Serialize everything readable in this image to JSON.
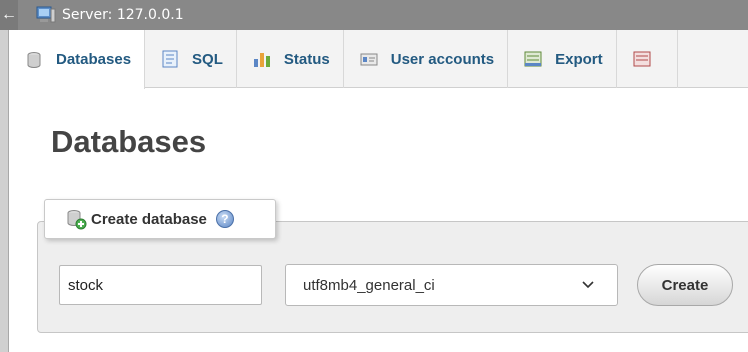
{
  "server_bar": {
    "back_icon": "left-arrow-icon",
    "server_icon": "server-icon",
    "label": "Server: 127.0.0.1"
  },
  "tabs": [
    {
      "label": "Databases",
      "icon": "database-icon",
      "active": true
    },
    {
      "label": "SQL",
      "icon": "sql-icon",
      "active": false
    },
    {
      "label": "Status",
      "icon": "status-chart-icon",
      "active": false
    },
    {
      "label": "User accounts",
      "icon": "user-accounts-icon",
      "active": false
    },
    {
      "label": "Export",
      "icon": "export-icon",
      "active": false
    },
    {
      "label": "",
      "icon": "import-icon",
      "active": false
    }
  ],
  "page": {
    "title": "Databases"
  },
  "create_database": {
    "legend": "Create database",
    "help_icon": "help-icon",
    "name_value": "stock",
    "collation_value": "utf8mb4_general_ci",
    "create_label": "Create"
  },
  "colors": {
    "server_bar": "#888888",
    "tab_text": "#235a81",
    "panel_bg": "#eeeeee"
  }
}
